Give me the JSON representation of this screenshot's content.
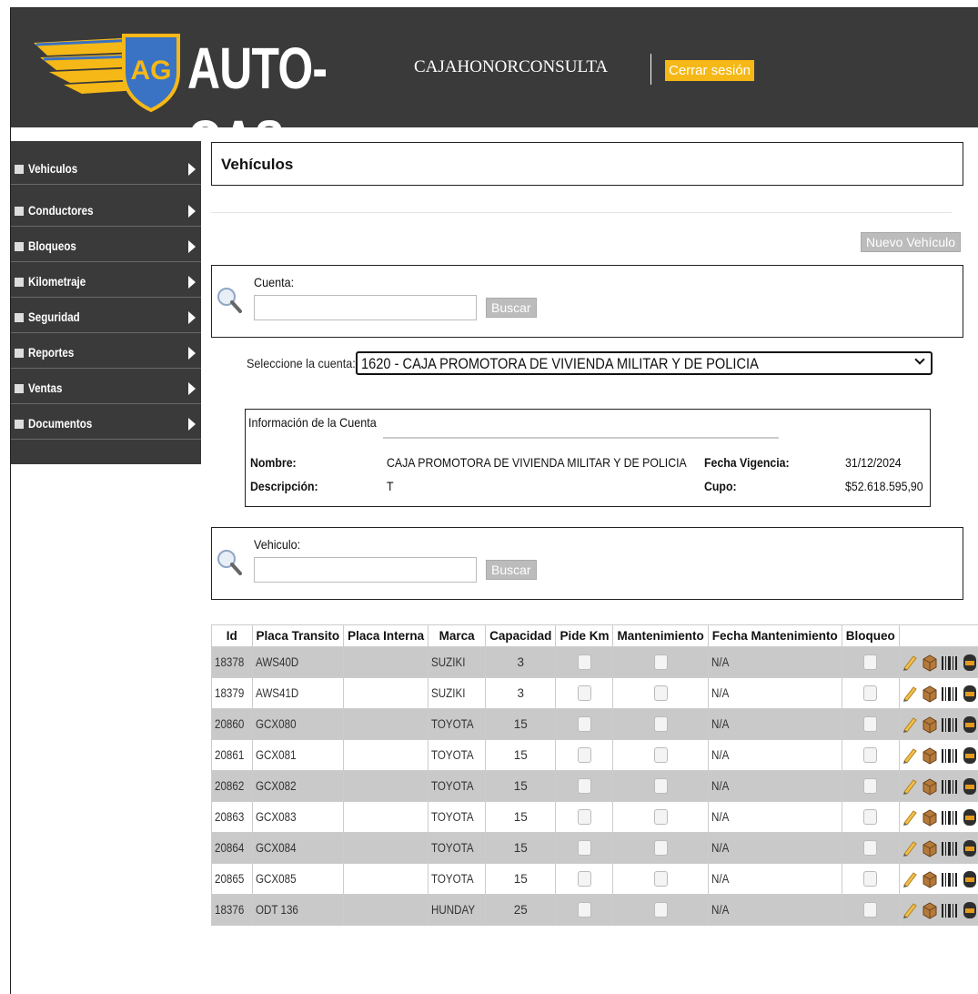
{
  "header": {
    "logo_badge": "AG",
    "logo_text": "AUTO-GAS",
    "user": "CAJAHONORCONSULTA",
    "logout": "Cerrar sesión",
    "brand_color": "#f5b817"
  },
  "sidebar": {
    "items": [
      {
        "label": "Vehiculos"
      },
      {
        "label": "Conductores"
      },
      {
        "label": "Bloqueos"
      },
      {
        "label": "Kilometraje"
      },
      {
        "label": "Seguridad"
      },
      {
        "label": "Reportes"
      },
      {
        "label": "Ventas"
      },
      {
        "label": "Documentos"
      }
    ]
  },
  "main": {
    "title": "Vehículos",
    "new_button": "Nuevo Vehículo",
    "account_search": {
      "label": "Cuenta:",
      "value": "",
      "button": "Buscar"
    },
    "select_label": "Seleccione la cuenta:",
    "select_value": "1620 - CAJA PROMOTORA DE VIVIENDA MILITAR Y DE POLICIA",
    "info": {
      "title": "Información de la Cuenta",
      "nombre_label": "Nombre:",
      "nombre": "CAJA PROMOTORA DE VIVIENDA MILITAR Y DE POLICIA",
      "descripcion_label": "Descripción:",
      "descripcion": "T",
      "fecha_label": "Fecha Vigencia:",
      "fecha": "31/12/2024",
      "cupo_label": "Cupo:",
      "cupo": "$52.618.595,90"
    },
    "vehicle_search": {
      "label": "Vehiculo:",
      "value": "",
      "button": "Buscar"
    }
  },
  "table": {
    "headers": [
      "Id",
      "Placa Transito",
      "Placa Interna",
      "Marca",
      "Capacidad",
      "Pide Km",
      "Mantenimiento",
      "Fecha Mantenimiento",
      "Bloqueo",
      ""
    ],
    "rows": [
      {
        "id": "18378",
        "placa": "AWS40D",
        "interna": "",
        "marca": "SUZIKI",
        "capacidad": "3",
        "fecha": "N/A"
      },
      {
        "id": "18379",
        "placa": "AWS41D",
        "interna": "",
        "marca": "SUZIKI",
        "capacidad": "3",
        "fecha": "N/A"
      },
      {
        "id": "20860",
        "placa": "GCX080",
        "interna": "",
        "marca": "TOYOTA",
        "capacidad": "15",
        "fecha": "N/A"
      },
      {
        "id": "20861",
        "placa": "GCX081",
        "interna": "",
        "marca": "TOYOTA",
        "capacidad": "15",
        "fecha": "N/A"
      },
      {
        "id": "20862",
        "placa": "GCX082",
        "interna": "",
        "marca": "TOYOTA",
        "capacidad": "15",
        "fecha": "N/A"
      },
      {
        "id": "20863",
        "placa": "GCX083",
        "interna": "",
        "marca": "TOYOTA",
        "capacidad": "15",
        "fecha": "N/A"
      },
      {
        "id": "20864",
        "placa": "GCX084",
        "interna": "",
        "marca": "TOYOTA",
        "capacidad": "15",
        "fecha": "N/A"
      },
      {
        "id": "20865",
        "placa": "GCX085",
        "interna": "",
        "marca": "TOYOTA",
        "capacidad": "15",
        "fecha": "N/A"
      },
      {
        "id": "18376",
        "placa": "ODT 136",
        "interna": "",
        "marca": "HUNDAY",
        "capacidad": "25",
        "fecha": "N/A"
      }
    ],
    "row_icons": [
      "edit-icon",
      "package-icon",
      "barcode-icon",
      "stop-light-icon",
      "delete-icon"
    ]
  }
}
